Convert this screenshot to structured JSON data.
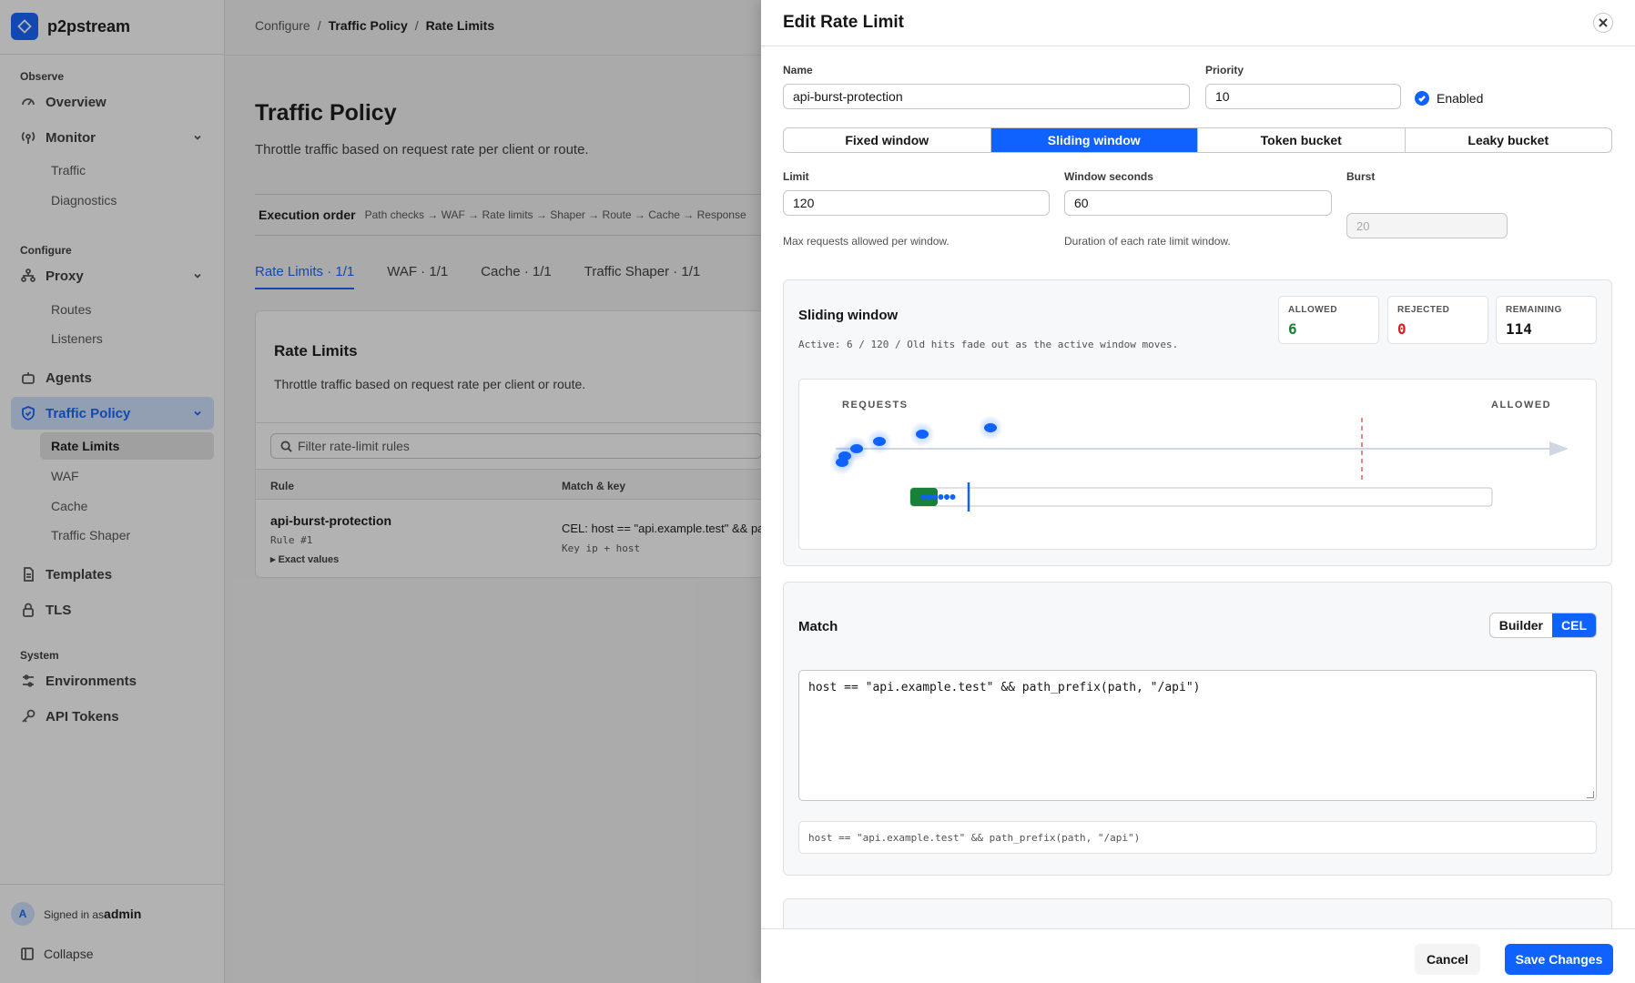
{
  "app": {
    "name": "p2pstream"
  },
  "sidebar": {
    "sections": {
      "observe": "Observe",
      "configure": "Configure",
      "system": "System"
    },
    "items": {
      "overview": "Overview",
      "monitor": "Monitor",
      "traffic": "Traffic",
      "diagnostics": "Diagnostics",
      "proxy": "Proxy",
      "routes": "Routes",
      "listeners": "Listeners",
      "agents": "Agents",
      "traffic_policy": "Traffic Policy",
      "rate_limits": "Rate Limits",
      "waf": "WAF",
      "cache": "Cache",
      "traffic_shaper": "Traffic Shaper",
      "templates": "Templates",
      "tls": "TLS",
      "environments": "Environments",
      "api_tokens": "API Tokens"
    },
    "footer": {
      "avatar_initial": "A",
      "signed_in_prefix": "Signed in as",
      "user": "admin",
      "collapse": "Collapse"
    }
  },
  "breadcrumb": [
    "Configure",
    "Traffic Policy",
    "Rate Limits"
  ],
  "page": {
    "title": "Traffic Policy",
    "description": "Throttle traffic based on request rate per client or route.",
    "execution_order_label": "Execution order",
    "execution_order": "Path checks → WAF → Rate limits → Shaper → Route → Cache → Response",
    "tabs": [
      "Rate Limits · 1/1",
      "WAF · 1/1",
      "Cache · 1/1",
      "Traffic Shaper · 1/1"
    ],
    "active_tab": 0
  },
  "rate_limits_card": {
    "title": "Rate Limits",
    "description": "Throttle traffic based on request rate per client or route.",
    "filter_placeholder": "Filter rate-limit rules",
    "columns": [
      "Rule",
      "Match & key"
    ],
    "rows": [
      {
        "name": "api-burst-protection",
        "number": "Rule #1",
        "exact": "Exact values",
        "match": "CEL: host == \"api.example.test\" && path_p",
        "key": "Key ip + host"
      }
    ]
  },
  "drawer": {
    "title": "Edit Rate Limit",
    "name_label": "Name",
    "name_value": "api-burst-protection",
    "priority_label": "Priority",
    "priority_value": "10",
    "enabled_label": "Enabled",
    "enabled": true,
    "algorithms": [
      "Fixed window",
      "Sliding window",
      "Token bucket",
      "Leaky bucket"
    ],
    "active_algorithm": 1,
    "limit_label": "Limit",
    "limit_value": "120",
    "limit_help": "Max requests allowed per window.",
    "window_label": "Window seconds",
    "window_value": "60",
    "window_help": "Duration of each rate limit window.",
    "burst_label": "Burst",
    "burst_placeholder": "20",
    "sim": {
      "title": "Sliding window",
      "active_text": "Active: 6 / 120 / Old hits fade out as the active window moves.",
      "allowed_label": "ALLOWED",
      "allowed": "6",
      "rejected_label": "REJECTED",
      "rejected": "0",
      "remaining_label": "REMAINING",
      "remaining": "114",
      "requests_label": "REQUESTS",
      "allowed_axis_label": "ALLOWED",
      "hits": 6,
      "limit": 120
    },
    "match": {
      "title": "Match",
      "modes": [
        "Builder",
        "CEL"
      ],
      "active_mode": 1,
      "expression": "host == \"api.example.test\" && path_prefix(path, \"/api\")",
      "preview": "host == \"api.example.test\" && path_prefix(path, \"/api\")"
    },
    "buttons": {
      "cancel": "Cancel",
      "save": "Save Changes"
    }
  },
  "colors": {
    "accent": "#0f62fe",
    "allowed": "#198038",
    "rejected": "#da1e28",
    "sidebar_active": "#d0e2ff"
  }
}
